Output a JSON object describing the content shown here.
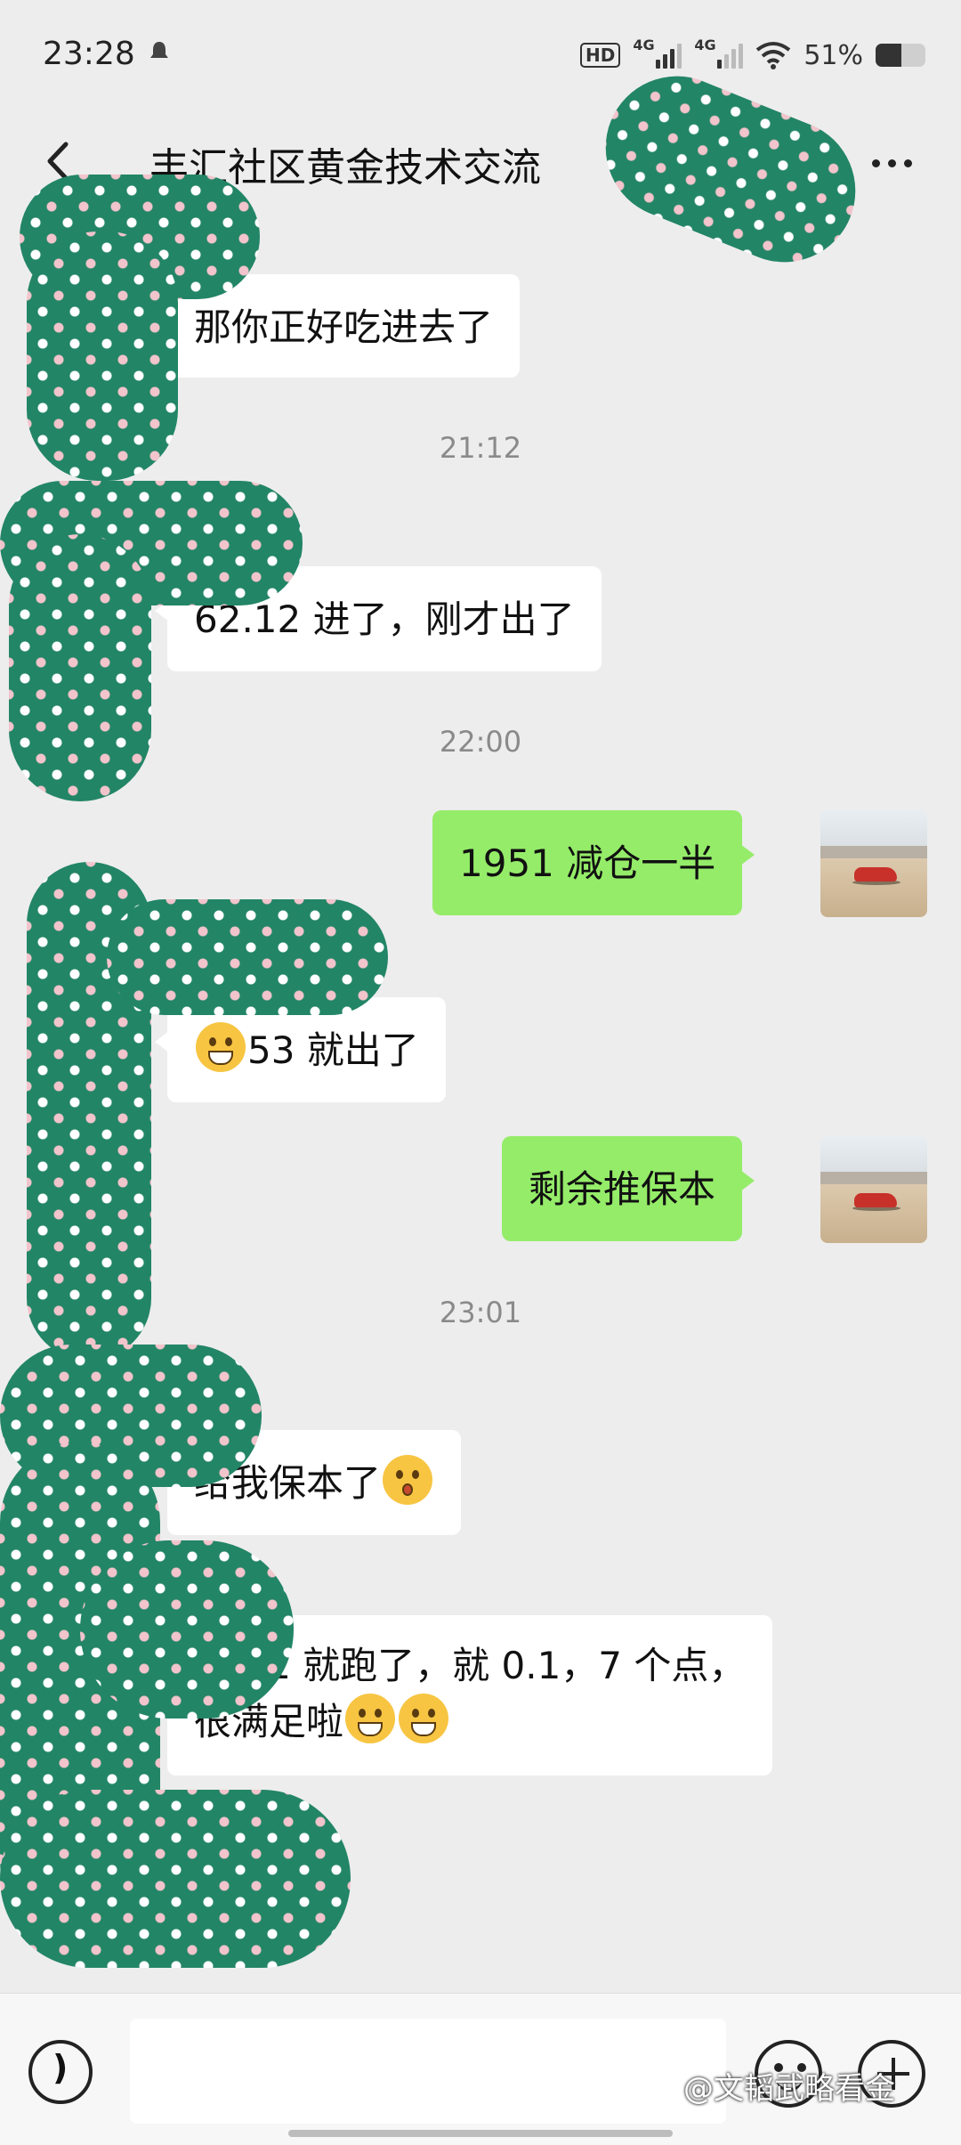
{
  "status_bar": {
    "time": "23:28",
    "hd_label": "HD",
    "net1": "4G",
    "net2": "4G",
    "battery": "51%",
    "battery_level": 0.51
  },
  "header": {
    "title": "丰汇社区黄金技术交流"
  },
  "messages": [
    {
      "type": "in",
      "text": "那你正好吃进去了"
    },
    {
      "type": "timestamp",
      "text": "21:12"
    },
    {
      "type": "in",
      "text": "62.12 进了，刚才出了"
    },
    {
      "type": "timestamp",
      "text": "22:00"
    },
    {
      "type": "out",
      "text": "1951 减仓一半"
    },
    {
      "type": "in",
      "emoji": "grimace",
      "text": "53 就出了"
    },
    {
      "type": "out",
      "text": "剩余推保本"
    },
    {
      "type": "timestamp",
      "text": "23:01"
    },
    {
      "type": "in",
      "text": "给我保本了",
      "emoji": "blush"
    },
    {
      "type": "in",
      "line1": "我 51 就跑了，就 0.1，7 个点，",
      "line2": "很满足啦",
      "emoji": [
        "grin",
        "grin"
      ]
    }
  ],
  "input_bar": {
    "icons": [
      "voice-icon",
      "emoji-icon",
      "plus-icon"
    ]
  },
  "watermark": "@文韬武略看金",
  "colors": {
    "outgoing_bubble": "#95ec69",
    "incoming_bubble": "#ffffff",
    "background": "#ededed",
    "mask": "#228566"
  }
}
